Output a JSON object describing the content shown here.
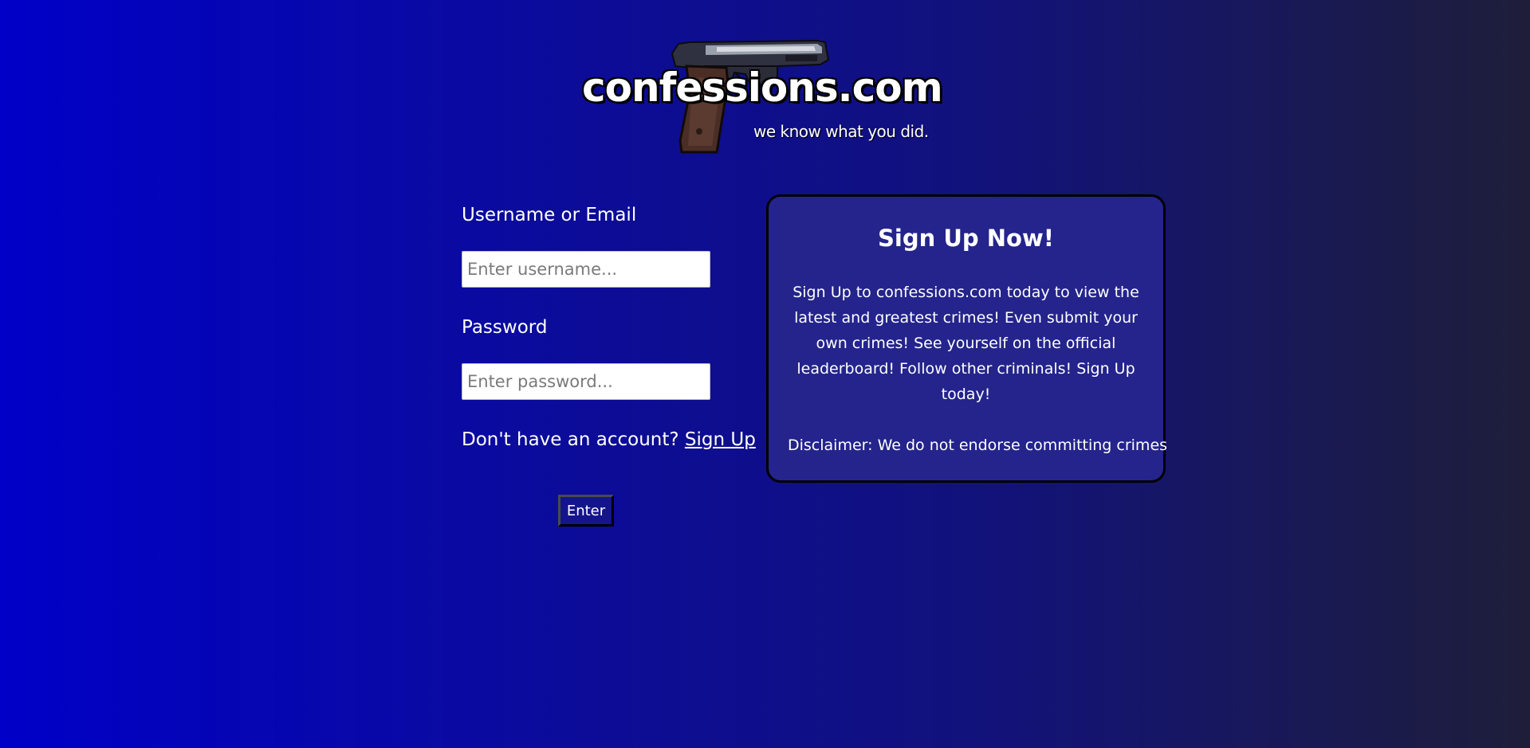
{
  "logo": {
    "wordmark": "confessions.com",
    "tagline": "we know what you did."
  },
  "login": {
    "username_label": "Username or Email",
    "username_placeholder": "Enter username...",
    "username_value": "",
    "password_label": "Password",
    "password_placeholder": "Enter password...",
    "password_value": "",
    "signup_prompt": "Don't have an account? ",
    "signup_link": "Sign Up",
    "enter_button": "Enter"
  },
  "promo": {
    "title": "Sign Up Now!",
    "body": "Sign Up to confessions.com today to view the latest and greatest crimes! Even submit your own crimes! See yourself on the official leaderboard! Follow other criminals! Sign Up today!",
    "disclaimer": "Disclaimer: We do not endorse committing crimes"
  },
  "icons": {
    "logo_graphic": "pistol-icon"
  },
  "colors": {
    "background_start": "#0000c8",
    "background_end": "#1e1e3a",
    "card_background": "#24248c",
    "button_background": "#15158a",
    "text": "#ffffff"
  }
}
